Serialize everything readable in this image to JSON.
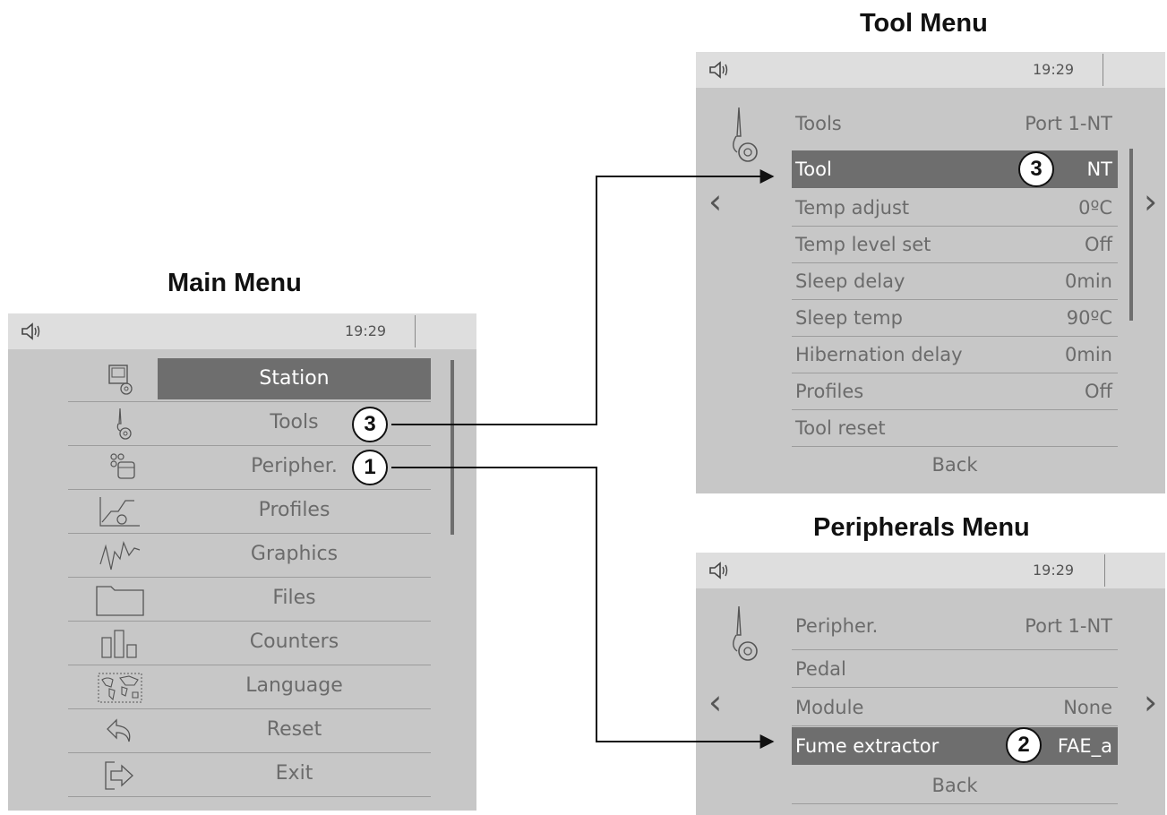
{
  "headings": {
    "main": "Main Menu",
    "tool": "Tool Menu",
    "peripherals": "Peripherals Menu"
  },
  "status": {
    "time": "19:29",
    "sound_icon": "speaker-icon"
  },
  "main_menu": {
    "items": [
      {
        "label": "Station",
        "icon": "station-icon",
        "selected": true
      },
      {
        "label": "Tools",
        "icon": "soldering-tool-icon",
        "badge": "3"
      },
      {
        "label": "Peripher.",
        "icon": "peripherals-icon",
        "badge": "1"
      },
      {
        "label": "Profiles",
        "icon": "profile-graph-icon"
      },
      {
        "label": "Graphics",
        "icon": "waveform-icon"
      },
      {
        "label": "Files",
        "icon": "folder-icon"
      },
      {
        "label": "Counters",
        "icon": "bar-counter-icon"
      },
      {
        "label": "Language",
        "icon": "world-map-icon"
      },
      {
        "label": "Reset",
        "icon": "reset-arrow-icon"
      },
      {
        "label": "Exit",
        "icon": "exit-icon"
      }
    ]
  },
  "tool_menu": {
    "title": "Tools",
    "port": "Port 1-NT",
    "rows": [
      {
        "label": "Tool",
        "value": "NT",
        "highlighted": true,
        "badge": "3"
      },
      {
        "label": "Temp adjust",
        "value": "0ºC"
      },
      {
        "label": "Temp level set",
        "value": "Off"
      },
      {
        "label": "Sleep delay",
        "value": "0min"
      },
      {
        "label": "Sleep temp",
        "value": "90ºC"
      },
      {
        "label": "Hibernation delay",
        "value": "0min"
      },
      {
        "label": "Profiles",
        "value": "Off"
      },
      {
        "label": "Tool reset",
        "value": ""
      }
    ],
    "back": "Back"
  },
  "peripherals_menu": {
    "title": "Peripher.",
    "port": "Port 1-NT",
    "rows": [
      {
        "label": "Pedal",
        "value": ""
      },
      {
        "label": "Module",
        "value": "None"
      },
      {
        "label": "Fume extractor",
        "value": "FAE_a",
        "highlighted": true,
        "badge": "2"
      }
    ],
    "back": "Back"
  },
  "nav": {
    "prev": "‹",
    "next": "›"
  }
}
